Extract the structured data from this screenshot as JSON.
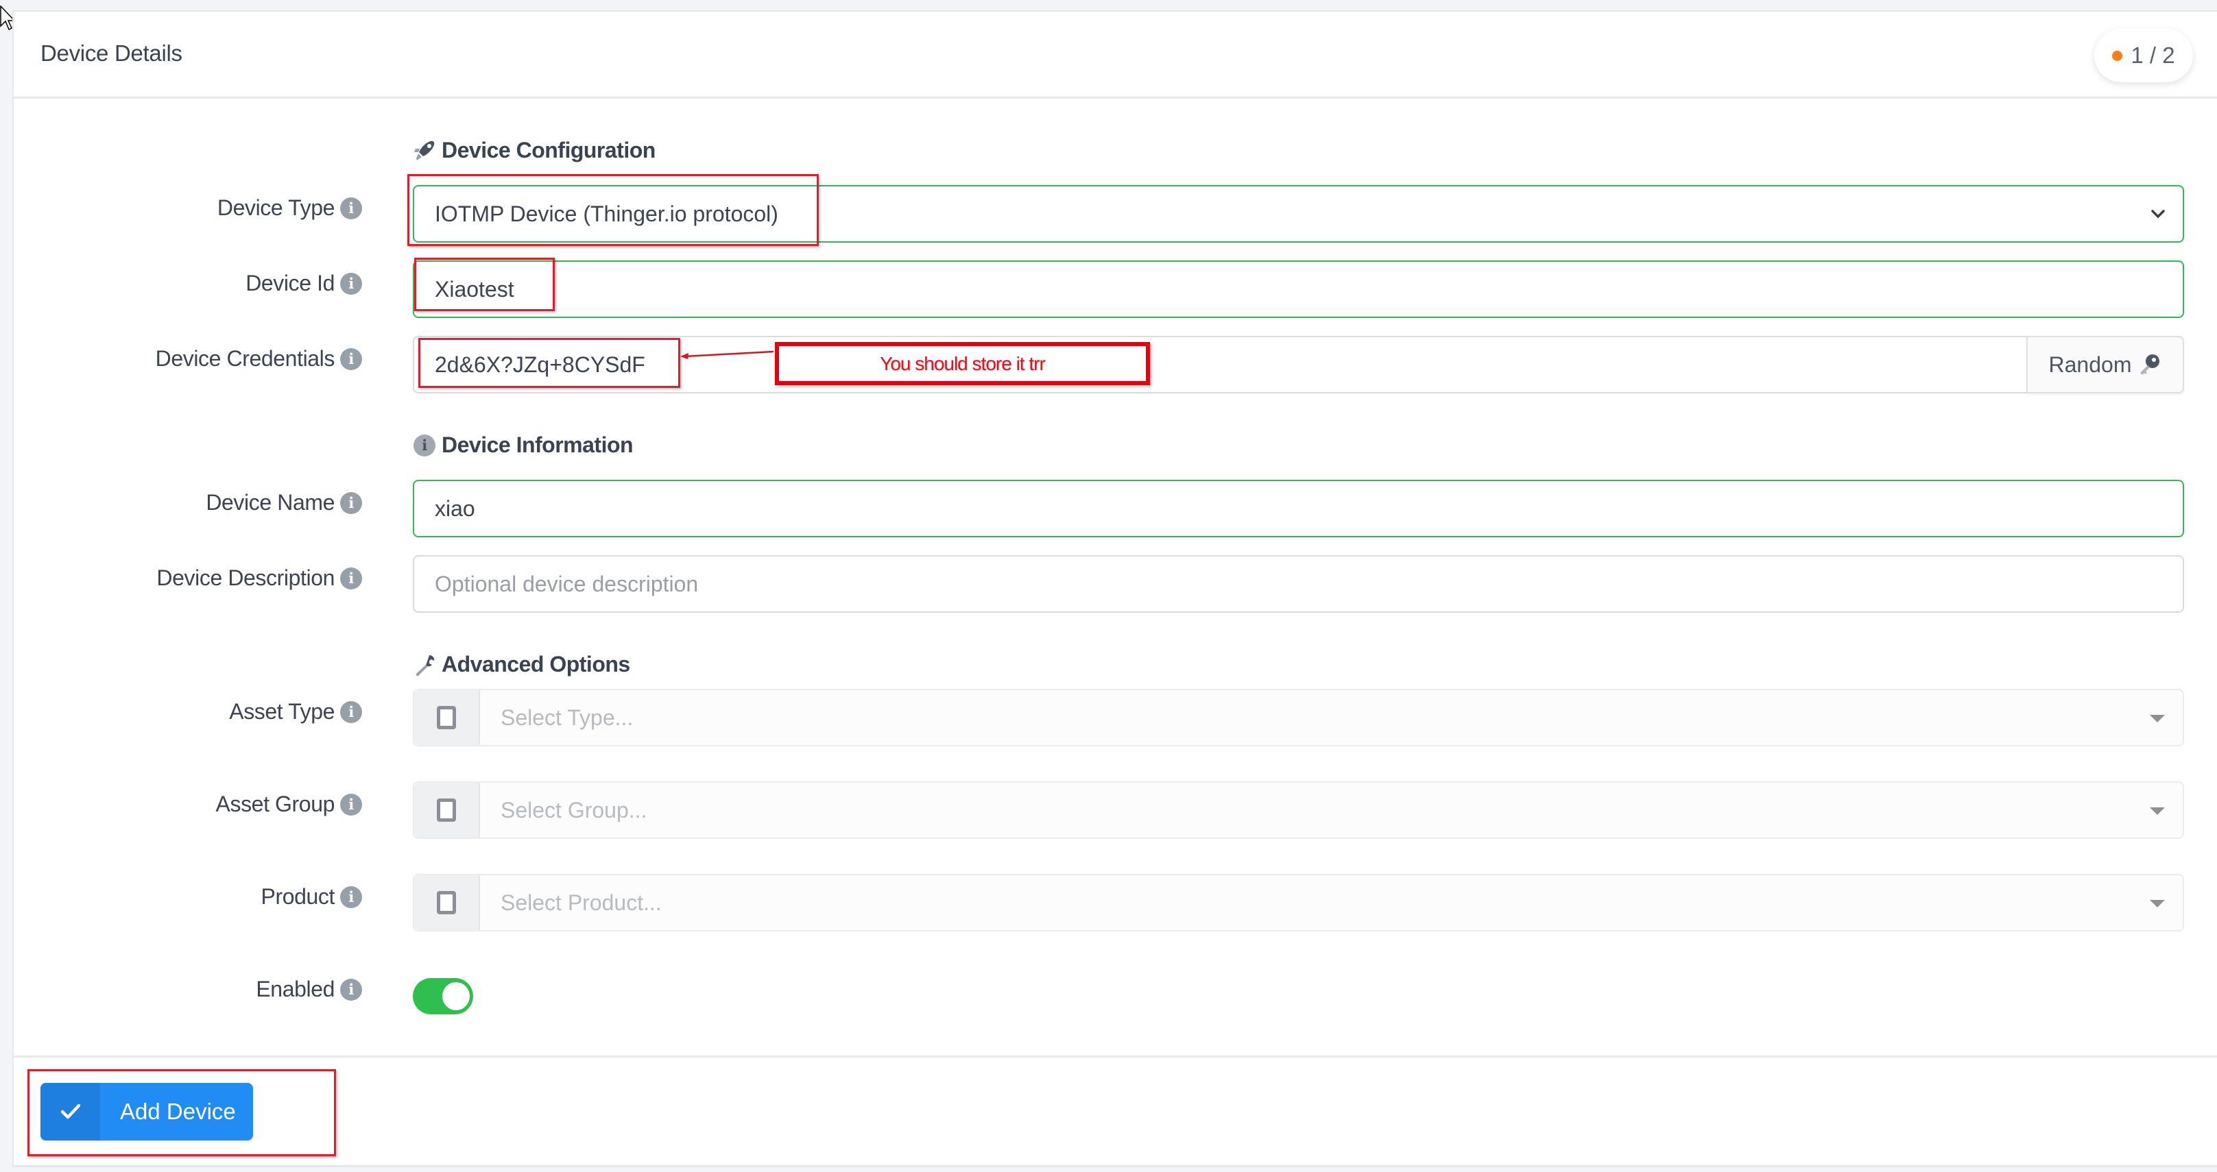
{
  "card": {
    "title": "Device Details",
    "step_indicator": {
      "current": "1 / 2",
      "dot_color": "#fd7e14"
    }
  },
  "sections": {
    "configuration": {
      "title": "Device Configuration",
      "icon": "rocket-icon"
    },
    "information": {
      "title": "Device Information",
      "icon": "info-icon"
    },
    "advanced": {
      "title": "Advanced Options",
      "icon": "wrench-icon"
    }
  },
  "fields": {
    "device_type": {
      "label": "Device Type",
      "value": "IOTMP Device (Thinger.io protocol)"
    },
    "device_id": {
      "label": "Device Id",
      "value": "Xiaotest"
    },
    "device_credentials": {
      "label": "Device Credentials",
      "value": "2d&6X?JZq+8CYSdF",
      "random_label": "Random"
    },
    "device_name": {
      "label": "Device Name",
      "value": "xiao"
    },
    "device_description": {
      "label": "Device Description",
      "value": "",
      "placeholder": "Optional device description"
    },
    "asset_type": {
      "label": "Asset Type",
      "placeholder": "Select Type..."
    },
    "asset_group": {
      "label": "Asset Group",
      "placeholder": "Select Group..."
    },
    "product": {
      "label": "Product",
      "placeholder": "Select Product..."
    },
    "enabled": {
      "label": "Enabled",
      "value": true
    }
  },
  "footer": {
    "submit_label": "Add Device"
  },
  "annotations": {
    "note": "You should store it trr",
    "color": "#e01d2b"
  },
  "colors": {
    "valid_border": "#35b65a",
    "primary": "#218cf4",
    "toggle_on": "#2fbf4f"
  }
}
